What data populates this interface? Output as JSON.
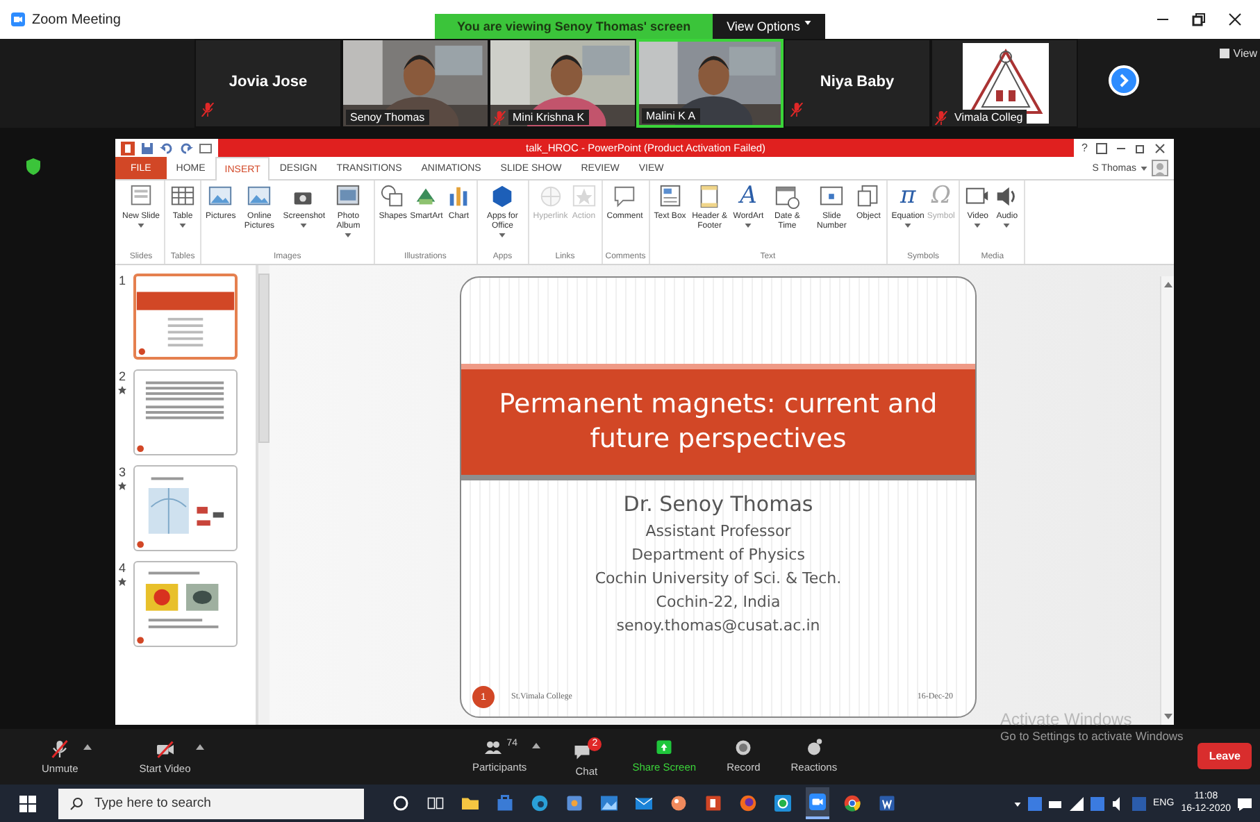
{
  "window": {
    "title": "Zoom Meeting"
  },
  "share_banner": {
    "text": "You are viewing Senoy Thomas' screen",
    "view_options": "View Options"
  },
  "gallery": {
    "view_label": "View",
    "tiles": [
      {
        "kind": "name",
        "name": "Jovia Jose",
        "muted": true,
        "speaking": false
      },
      {
        "kind": "video",
        "name": "Senoy Thomas",
        "muted": false,
        "speaking": false
      },
      {
        "kind": "video",
        "name": "Mini Krishna K",
        "muted": true,
        "speaking": false
      },
      {
        "kind": "video",
        "name": "Malini K A",
        "muted": false,
        "speaking": true
      },
      {
        "kind": "name",
        "name": "Niya Baby",
        "muted": true,
        "speaking": false
      },
      {
        "kind": "logo",
        "name": "Vimala Colleg",
        "muted": true,
        "speaking": false
      }
    ]
  },
  "powerpoint": {
    "title": "talk_HROC - PowerPoint (Product Activation Failed)",
    "help": "?",
    "user": "S Thomas",
    "tabs": [
      {
        "label": "FILE",
        "kind": "file",
        "selected": false
      },
      {
        "label": "HOME",
        "kind": "tab",
        "selected": false
      },
      {
        "label": "INSERT",
        "kind": "tab",
        "selected": true
      },
      {
        "label": "DESIGN",
        "kind": "tab",
        "selected": false
      },
      {
        "label": "TRANSITIONS",
        "kind": "tab",
        "selected": false
      },
      {
        "label": "ANIMATIONS",
        "kind": "tab",
        "selected": false
      },
      {
        "label": "SLIDE SHOW",
        "kind": "tab",
        "selected": false
      },
      {
        "label": "REVIEW",
        "kind": "tab",
        "selected": false
      },
      {
        "label": "VIEW",
        "kind": "tab",
        "selected": false
      }
    ],
    "ribbon_groups": [
      {
        "name": "Slides",
        "commands": [
          {
            "label": "New Slide",
            "kind": "slide",
            "dropdown": true,
            "disabled": false
          }
        ]
      },
      {
        "name": "Tables",
        "commands": [
          {
            "label": "Table",
            "kind": "table",
            "dropdown": true,
            "disabled": false
          }
        ]
      },
      {
        "name": "Images",
        "commands": [
          {
            "label": "Pictures",
            "kind": "picture",
            "dropdown": false,
            "disabled": false
          },
          {
            "label": "Online Pictures",
            "kind": "picture",
            "dropdown": false,
            "disabled": false
          },
          {
            "label": "Screenshot",
            "kind": "camera",
            "dropdown": true,
            "disabled": false
          },
          {
            "label": "Photo Album",
            "kind": "album",
            "dropdown": true,
            "disabled": false
          }
        ]
      },
      {
        "name": "Illustrations",
        "commands": [
          {
            "label": "Shapes",
            "kind": "shapes",
            "dropdown": false,
            "disabled": false
          },
          {
            "label": "SmartArt",
            "kind": "smartart",
            "dropdown": false,
            "disabled": false
          },
          {
            "label": "Chart",
            "kind": "chart",
            "dropdown": false,
            "disabled": false
          }
        ]
      },
      {
        "name": "Apps",
        "commands": [
          {
            "label": "Apps for Office",
            "kind": "apps",
            "dropdown": true,
            "disabled": false
          }
        ]
      },
      {
        "name": "Links",
        "commands": [
          {
            "label": "Hyperlink",
            "kind": "globe",
            "dropdown": false,
            "disabled": true
          },
          {
            "label": "Action",
            "kind": "star",
            "dropdown": false,
            "disabled": true
          }
        ]
      },
      {
        "name": "Comments",
        "commands": [
          {
            "label": "Comment",
            "kind": "comment",
            "dropdown": false,
            "disabled": false
          }
        ]
      },
      {
        "name": "Text",
        "commands": [
          {
            "label": "Text Box",
            "kind": "textbox",
            "dropdown": false,
            "disabled": false
          },
          {
            "label": "Header & Footer",
            "kind": "page",
            "dropdown": false,
            "disabled": false
          },
          {
            "label": "WordArt",
            "kind": "glyph",
            "glyph": "A",
            "dropdown": true,
            "disabled": false
          },
          {
            "label": "Date & Time",
            "kind": "calendar",
            "dropdown": false,
            "disabled": false
          },
          {
            "label": "Slide Number",
            "kind": "number",
            "dropdown": false,
            "disabled": false
          },
          {
            "label": "Object",
            "kind": "object",
            "dropdown": false,
            "disabled": false
          }
        ]
      },
      {
        "name": "Symbols",
        "commands": [
          {
            "label": "Equation",
            "kind": "glyph",
            "glyph": "π",
            "dropdown": true,
            "disabled": false
          },
          {
            "label": "Symbol",
            "kind": "glyph",
            "glyph": "Ω",
            "dropdown": false,
            "disabled": true
          }
        ]
      },
      {
        "name": "Media",
        "commands": [
          {
            "label": "Video",
            "kind": "film",
            "dropdown": true,
            "disabled": false
          },
          {
            "label": "Audio",
            "kind": "speaker",
            "dropdown": true,
            "disabled": false
          }
        ]
      }
    ],
    "thumbnails": [
      {
        "number": "1",
        "kind": "title",
        "selected": true,
        "animated": false
      },
      {
        "number": "2",
        "kind": "text",
        "selected": false,
        "animated": true
      },
      {
        "number": "3",
        "kind": "diagram",
        "selected": false,
        "animated": true
      },
      {
        "number": "4",
        "kind": "images",
        "selected": false,
        "animated": true
      }
    ],
    "slide": {
      "title": "Permanent magnets: current and future perspectives",
      "lines": [
        {
          "text": "Dr. Senoy Thomas",
          "kind": "name"
        },
        {
          "text": "Assistant Professor",
          "kind": "line"
        },
        {
          "text": "Department of Physics",
          "kind": "line"
        },
        {
          "text": "Cochin University of Sci. & Tech.",
          "kind": "line"
        },
        {
          "text": "Cochin-22, India",
          "kind": "line"
        },
        {
          "text": "senoy.thomas@cusat.ac.in",
          "kind": "line"
        }
      ],
      "number": "1",
      "footer": "St.Vimala College",
      "date": "16-Dec-20"
    }
  },
  "activation": {
    "title": "Activate Windows",
    "hint": "Go to Settings to activate Windows"
  },
  "controls": [
    {
      "label": "Unmute",
      "kind": "mic",
      "menu": true
    },
    {
      "label": "Start Video",
      "kind": "camera",
      "menu": true
    },
    {
      "label": "Participants",
      "kind": "people",
      "count": "74",
      "menu": true
    },
    {
      "label": "Chat",
      "kind": "chat",
      "badge": "2",
      "menu": false
    },
    {
      "label": "Share Screen",
      "kind": "share",
      "menu": false
    },
    {
      "label": "Record",
      "kind": "record",
      "menu": false
    },
    {
      "label": "Reactions",
      "kind": "reaction",
      "menu": false
    }
  ],
  "leave": "Leave",
  "taskbar": {
    "search_placeholder": "Type here to search",
    "apps": [
      {
        "kind": "folder"
      },
      {
        "kind": "store"
      },
      {
        "kind": "edge"
      },
      {
        "kind": "app"
      },
      {
        "kind": "photos"
      },
      {
        "kind": "mail"
      },
      {
        "kind": "paint"
      },
      {
        "kind": "powerpoint"
      },
      {
        "kind": "firefox"
      },
      {
        "kind": "whatsapp"
      },
      {
        "kind": "zoom"
      },
      {
        "kind": "chrome"
      },
      {
        "kind": "word"
      }
    ],
    "language": "ENG",
    "time": "11:08",
    "date": "16-12-2020"
  }
}
